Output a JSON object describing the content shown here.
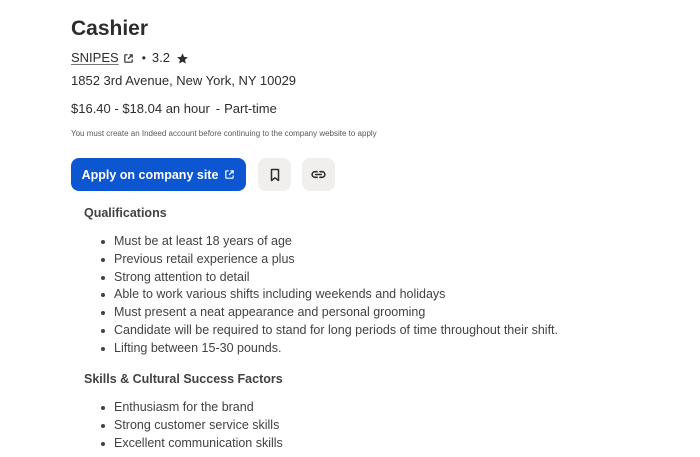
{
  "job": {
    "title": "Cashier",
    "company": "SNIPES",
    "dot": "•",
    "rating": "3.2",
    "location": "1852 3rd Avenue, New York, NY 10029",
    "salary": "$16.40 - $18.04 an hour",
    "separator": "-",
    "job_type": "Part-time",
    "notice": "You must create an Indeed account before continuing to the company website to apply"
  },
  "actions": {
    "apply_label": "Apply on company site"
  },
  "qualifications": {
    "heading": "Qualifications",
    "items": [
      "Must be at least 18 years of age",
      "Previous retail experience a plus",
      "Strong attention to detail",
      "Able to work various shifts including weekends and holidays",
      "Must present a neat appearance and personal grooming",
      "Candidate will be required to stand for long periods of time throughout their shift.",
      "Lifting between 15-30 pounds."
    ]
  },
  "skills": {
    "heading": "Skills & Cultural Success Factors",
    "items": [
      "Enthusiasm for the brand",
      "Strong customer service skills",
      "Excellent communication skills"
    ]
  },
  "colors": {
    "primary_button": "#0d56d1",
    "text": "#2d2d2d",
    "secondary_button_bg": "#f0efed"
  },
  "icons": {
    "external_link": "external-link-icon",
    "rating_star": "star-icon",
    "save": "bookmark-icon",
    "copy_link": "link-icon"
  }
}
